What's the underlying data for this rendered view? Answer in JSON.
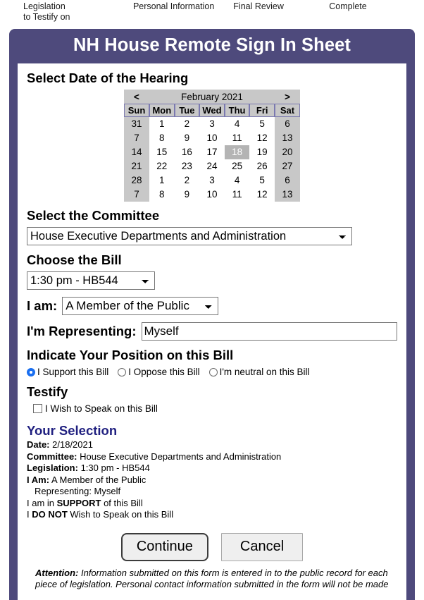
{
  "steps": [
    {
      "label": "Legislation\nto Testify on"
    },
    {
      "label": "Personal Information"
    },
    {
      "label": "Final Review"
    },
    {
      "label": "Complete"
    }
  ],
  "header": {
    "title": "NH House Remote Sign In Sheet",
    "bg_color": "#4e4a7c"
  },
  "sections": {
    "date_heading": "Select Date of the Hearing",
    "committee_heading": "Select the Committee",
    "bill_heading": "Choose the Bill",
    "position_heading": "Indicate Your Position on this Bill",
    "testify_heading": "Testify",
    "selection_heading": "Your Selection"
  },
  "calendar": {
    "prev_label": "<",
    "next_label": ">",
    "month_label": "February 2021",
    "day_headers": [
      "Sun",
      "Mon",
      "Tue",
      "Wed",
      "Thu",
      "Fri",
      "Sat"
    ],
    "selected_day": "18",
    "weeks": [
      [
        "31",
        "1",
        "2",
        "3",
        "4",
        "5",
        "6"
      ],
      [
        "7",
        "8",
        "9",
        "10",
        "11",
        "12",
        "13"
      ],
      [
        "14",
        "15",
        "16",
        "17",
        "18",
        "19",
        "20"
      ],
      [
        "21",
        "22",
        "23",
        "24",
        "25",
        "26",
        "27"
      ],
      [
        "28",
        "1",
        "2",
        "3",
        "4",
        "5",
        "6"
      ],
      [
        "7",
        "8",
        "9",
        "10",
        "11",
        "12",
        "13"
      ]
    ]
  },
  "committee": {
    "value": "House Executive Departments and Administration"
  },
  "bill": {
    "value": "1:30 pm - HB544"
  },
  "i_am": {
    "label": "I am:",
    "value": "A Member of the Public"
  },
  "representing": {
    "label": "I'm Representing:",
    "value": "Myself",
    "placeholder": ""
  },
  "position": {
    "options": [
      {
        "label": "I Support this Bill",
        "selected": true
      },
      {
        "label": "I Oppose this Bill",
        "selected": false
      },
      {
        "label": "I'm neutral on this Bill",
        "selected": false
      }
    ],
    "accent_color": "#1a6ff0"
  },
  "testify": {
    "checkbox_label": "I Wish to Speak on this Bill",
    "checked": false
  },
  "summary": {
    "heading_color": "#202080",
    "date_label": "Date:",
    "date_value": "2/18/2021",
    "committee_label": "Committee:",
    "committee_value": "House Executive Departments and Administration",
    "legislation_label": "Legislation:",
    "legislation_value": "1:30 pm - HB544",
    "iam_label": "I Am:",
    "iam_value": "A Member of the Public",
    "representing_line": "Representing: Myself",
    "position_pre": "I am in ",
    "position_strong": "SUPPORT",
    "position_post": " of this Bill",
    "speak_pre": "I ",
    "speak_strong": "DO NOT",
    "speak_post": " Wish to Speak on this Bill"
  },
  "buttons": {
    "continue": "Continue",
    "cancel": "Cancel"
  },
  "footnote": {
    "bold": "Attention:",
    "text": " Information submitted on this form is entered in to the public record for each piece of legislation. Personal contact information submitted in the form will not be made"
  }
}
